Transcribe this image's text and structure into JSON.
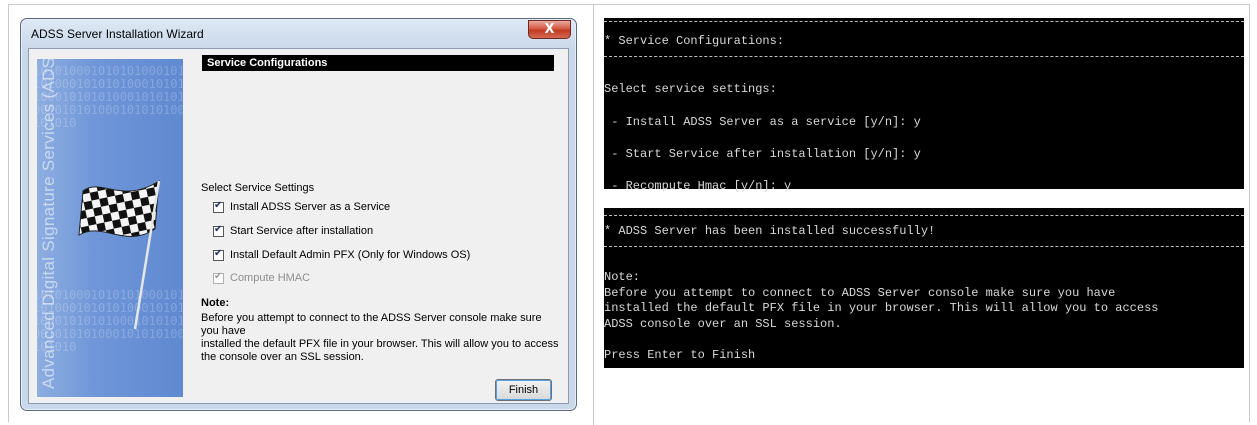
{
  "dialog": {
    "title": "ADSS Server Installation Wizard",
    "close_label": "X",
    "banner_text": "Advanced Digital Signature Services (ADSS)",
    "banner_bits": "1010100010101010001010101000101010100010101010001010101000101010100010101010001010101000101010",
    "section_title": "Service Configurations",
    "select_label": "Select Service Settings",
    "options": [
      {
        "label": "Install ADSS Server as a Service",
        "checked": true,
        "enabled": true
      },
      {
        "label": "Start Service after installation",
        "checked": true,
        "enabled": true
      },
      {
        "label": "Install Default Admin PFX (Only for Windows OS)",
        "checked": true,
        "enabled": true
      },
      {
        "label": "Compute HMAC",
        "checked": true,
        "enabled": false
      }
    ],
    "note_title": "Note:",
    "note_lines": [
      "Before you attempt to connect to the ADSS Server console make sure you have",
      "installed  the default PFX file in your browser. This will allow you to access",
      "the console over an SSL session."
    ],
    "finish_label": "Finish"
  },
  "terminal1": {
    "header": "* Service Configurations:",
    "lines": [
      "Select service settings:",
      " - Install ADSS Server as a service [y/n]: y",
      " - Start Service after installation [y/n]: y",
      " - Recompute Hmac [y/n]: y"
    ]
  },
  "terminal2": {
    "header": "* ADSS Server has been installed successfully!",
    "lines": [
      "Note:",
      "Before you attempt to connect to ADSS Server console make sure you have",
      "installed the default PFX file in your browser. This will allow you to access",
      "ADSS console over an SSL session.",
      "Press Enter to Finish"
    ]
  }
}
